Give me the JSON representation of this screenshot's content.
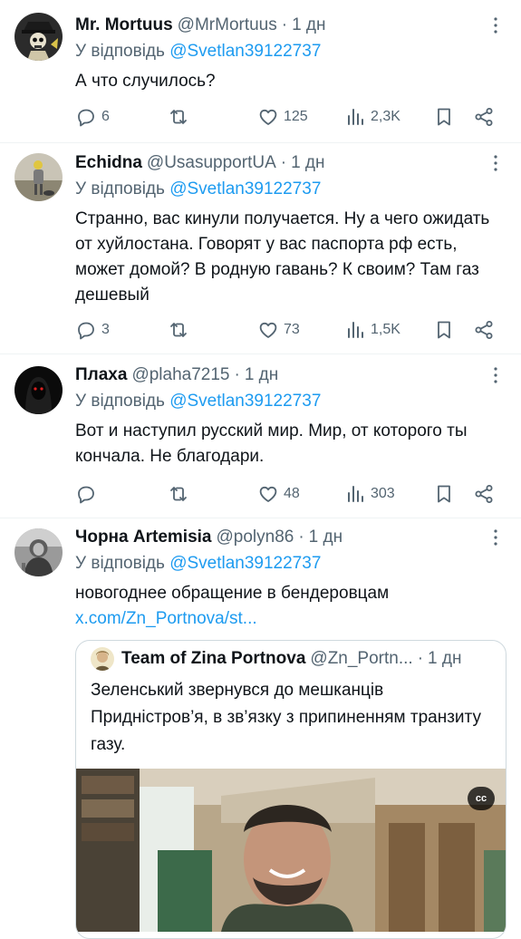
{
  "tweets": [
    {
      "name": "Mr. Mortuus",
      "handle": "@MrMortuus",
      "time": "1 дн",
      "reply_prefix": "У відповідь",
      "reply_to": "@Svetlan39122737",
      "text": "А что случилось?",
      "replies": "6",
      "retweets": "",
      "likes": "125",
      "views": "2,3K"
    },
    {
      "name": "Echidna",
      "handle": "@UsasupportUA",
      "time": "1 дн",
      "reply_prefix": "У відповідь",
      "reply_to": "@Svetlan39122737",
      "text": "Странно, вас кинули получается. Ну а чего ожидать от хуйлостана. Говорят у вас паспорта рф есть, может домой? В родную гавань? К своим? Там газ дешевый",
      "replies": "3",
      "retweets": "",
      "likes": "73",
      "views": "1,5K"
    },
    {
      "name": "Плаха",
      "handle": "@plaha7215",
      "time": "1 дн",
      "reply_prefix": "У відповідь",
      "reply_to": "@Svetlan39122737",
      "text": "Вот и наступил русский мир. Мир, от которого ты кончала. Не благодари.",
      "replies": "",
      "retweets": "",
      "likes": "48",
      "views": "303"
    },
    {
      "name": "Чорна Artemisia",
      "handle": "@polyn86",
      "time": "1 дн",
      "reply_prefix": "У відповідь",
      "reply_to": "@Svetlan39122737",
      "text": "новогоднее обращение в бендеровцам ",
      "link": "x.com/Zn_Portnova/st..."
    }
  ],
  "quote": {
    "name": "Team of Zina Portnova",
    "handle": "@Zn_Portn...",
    "time": "1 дн",
    "text": "Зеленський звернувся до мешканців Придністров’я, в зв’язку з припиненням транзиту газу.",
    "cc_label": "cc"
  },
  "separator": "·",
  "colors": {
    "accent": "#1d9bf0",
    "muted": "#536471",
    "text": "#0f1419",
    "border": "#eff3f4"
  },
  "icons": [
    "more-icon",
    "reply-icon",
    "retweet-icon",
    "like-icon",
    "views-icon",
    "bookmark-icon",
    "share-icon",
    "closed-captions-icon"
  ]
}
